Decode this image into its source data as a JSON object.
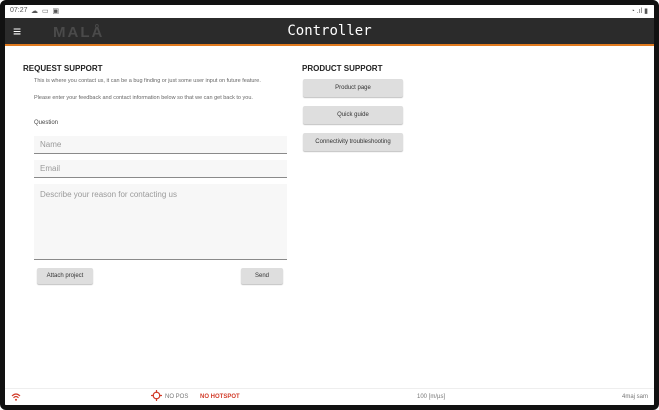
{
  "status_bar": {
    "time": "07:27",
    "system_icons": "☁ ▭ ▣",
    "right_icons": "◔ .ıl ▮"
  },
  "app_bar": {
    "menu_icon": "≡",
    "logo_text": "MALÅ",
    "title": "Controller"
  },
  "request_support": {
    "heading": "REQUEST SUPPORT",
    "description_line1": "This is where you contact us, it can be a bug finding or just some user input on future feature.",
    "description_line2": "Please enter your feedback and contact information below so that we can get back to you.",
    "question_label": "Question",
    "name_placeholder": "Name",
    "email_placeholder": "Email",
    "reason_placeholder": "Describe your reason for contacting us",
    "attach_button": "Attach project",
    "send_button": "Send"
  },
  "product_support": {
    "heading": "PRODUCT SUPPORT",
    "buttons": [
      "Product page",
      "Quick guide",
      "Connectivity troubleshooting"
    ]
  },
  "bottom_bar": {
    "no_pos": "NO POS",
    "no_hotspot": "NO HOTSPOT",
    "speed": "100 [m/µs]",
    "user": "4maj sam"
  },
  "colors": {
    "app_bar_bg": "#2b2b2b",
    "accent_orange": "#e07a1f",
    "alert_red": "#d23c2a",
    "button_bg": "#dedede"
  }
}
